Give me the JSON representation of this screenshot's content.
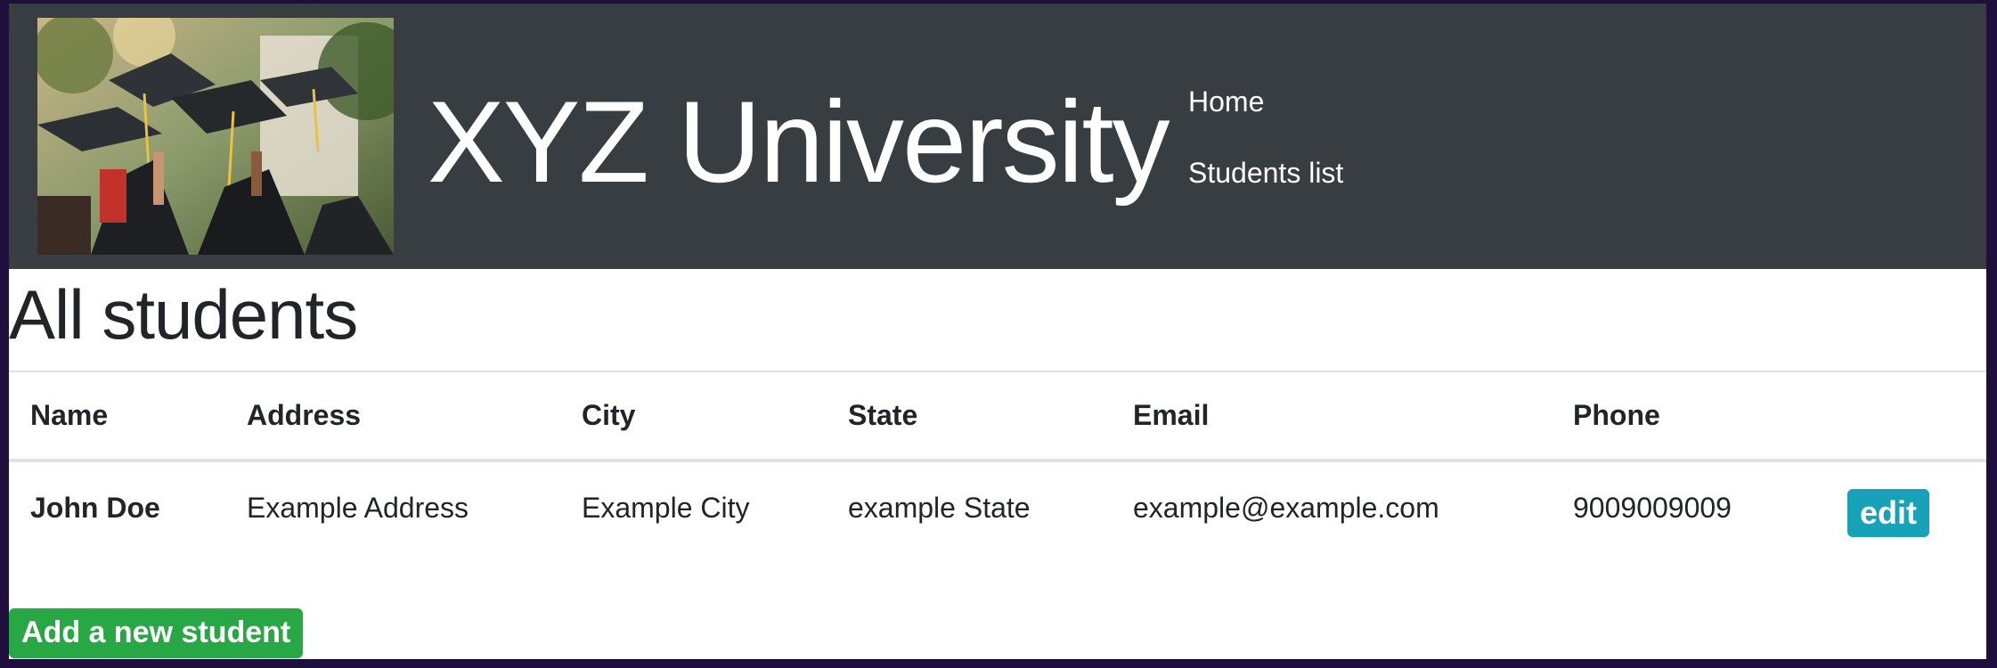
{
  "navbar": {
    "logo_alt": "graduation caps",
    "title": "XYZ University",
    "links": [
      {
        "label": "Home"
      },
      {
        "label": "Students list"
      }
    ]
  },
  "main": {
    "heading": "All students",
    "table": {
      "headers": [
        "Name",
        "Address",
        "City",
        "State",
        "Email",
        "Phone",
        ""
      ],
      "rows": [
        {
          "name": "John Doe",
          "address": "Example Address",
          "city": "Example City",
          "state": "example State",
          "email": "example@example.com",
          "phone": "9009009009",
          "action_label": "edit"
        }
      ]
    },
    "add_button_label": "Add a new student"
  },
  "colors": {
    "navbar_bg": "#383d41",
    "edit_button": "#17a2b8",
    "add_button": "#28a745",
    "text": "#212529"
  }
}
